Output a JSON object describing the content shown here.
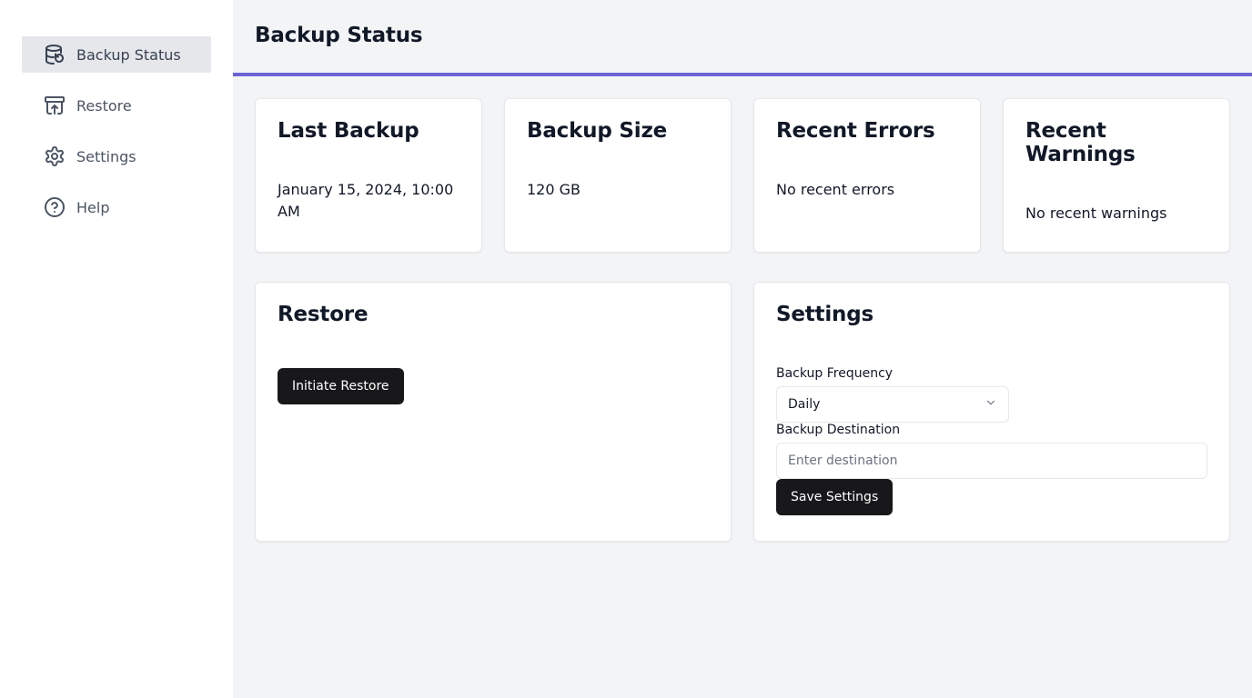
{
  "sidebar": {
    "items": [
      {
        "label": "Backup Status",
        "icon": "database-backup-icon",
        "active": true
      },
      {
        "label": "Restore",
        "icon": "archive-restore-icon",
        "active": false
      },
      {
        "label": "Settings",
        "icon": "gear-icon",
        "active": false
      },
      {
        "label": "Help",
        "icon": "help-circle-icon",
        "active": false
      }
    ]
  },
  "header": {
    "title": "Backup Status",
    "accent_color": "#6b63d6"
  },
  "stats": [
    {
      "title": "Last Backup",
      "value": "January 15, 2024, 10:00 AM"
    },
    {
      "title": "Backup Size",
      "value": "120 GB"
    },
    {
      "title": "Recent Errors",
      "value": "No recent errors"
    },
    {
      "title": "Recent Warnings",
      "value": "No recent warnings"
    }
  ],
  "restore": {
    "title": "Restore",
    "button_label": "Initiate Restore"
  },
  "settings": {
    "title": "Settings",
    "frequency_label": "Backup Frequency",
    "frequency_value": "Daily",
    "destination_label": "Backup Destination",
    "destination_placeholder": "Enter destination",
    "destination_value": "",
    "save_label": "Save Settings"
  }
}
